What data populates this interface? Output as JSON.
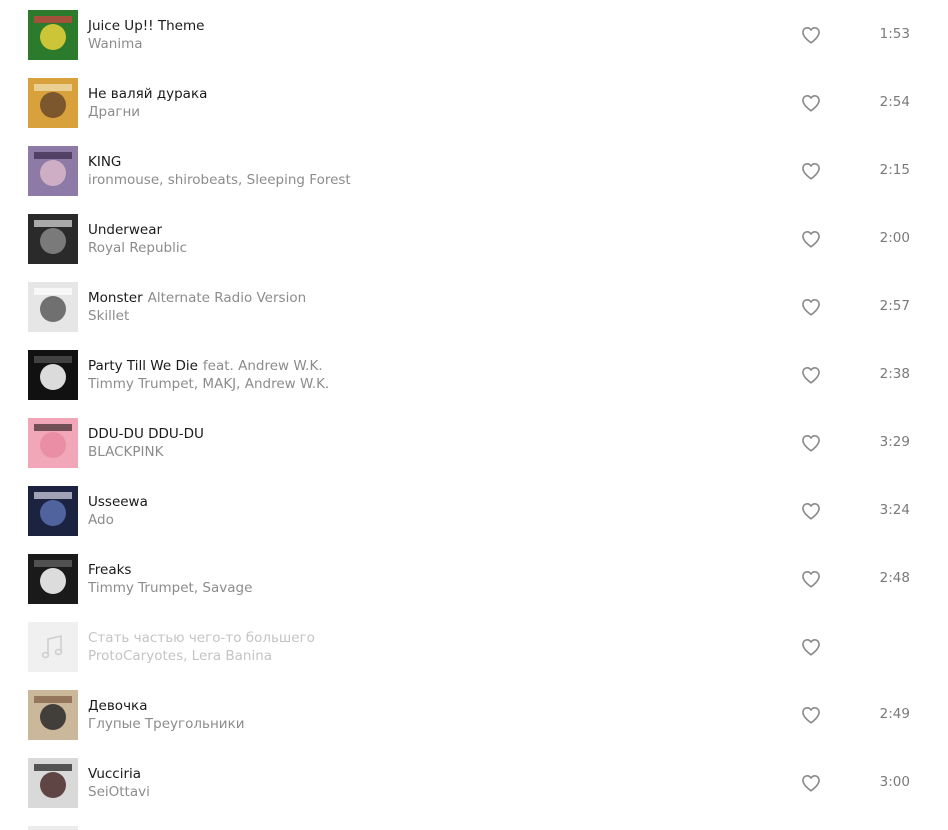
{
  "tracks": [
    {
      "title": "Juice Up!! Theme",
      "version": "",
      "artist": "Wanima",
      "duration": "1:53",
      "cover_icon": "album-cover",
      "cover_colors": [
        "#2c7a2c",
        "#e8d23a",
        "#d64040"
      ]
    },
    {
      "title": "Не валяй дурака",
      "version": "",
      "artist": "Драгни",
      "duration": "2:54",
      "cover_icon": "album-cover",
      "cover_colors": [
        "#d9a13c",
        "#6b4a2a",
        "#f1e3b8"
      ]
    },
    {
      "title": "KING",
      "version": "",
      "artist": "ironmouse, shirobeats, Sleeping Forest",
      "duration": "2:15",
      "cover_icon": "album-cover",
      "cover_colors": [
        "#8e7aa6",
        "#d9b7c9",
        "#3b2a4a"
      ]
    },
    {
      "title": "Underwear",
      "version": "",
      "artist": "Royal Republic",
      "duration": "2:00",
      "cover_icon": "album-cover",
      "cover_colors": [
        "#2a2a2a",
        "#888888",
        "#e0e0e0"
      ]
    },
    {
      "title": "Monster",
      "version": "Alternate Radio Version",
      "artist": "Skillet",
      "duration": "2:57",
      "cover_icon": "album-cover",
      "cover_colors": [
        "#e6e6e6",
        "#5a5a5a",
        "#ffffff"
      ]
    },
    {
      "title": "Party Till We Die",
      "version": "feat. Andrew W.K.",
      "artist": "Timmy Trumpet, MAKJ, Andrew W.K.",
      "duration": "2:38",
      "cover_icon": "album-cover",
      "cover_colors": [
        "#111111",
        "#ffffff",
        "#555555"
      ]
    },
    {
      "title": "DDU-DU DDU-DU",
      "version": "",
      "artist": "BLACKPINK",
      "duration": "3:29",
      "cover_icon": "album-cover",
      "cover_colors": [
        "#f2a7b8",
        "#e88aa0",
        "#3a2a2e"
      ]
    },
    {
      "title": "Usseewa",
      "version": "",
      "artist": "Ado",
      "duration": "3:24",
      "cover_icon": "album-cover",
      "cover_colors": [
        "#1b2340",
        "#5a6fb0",
        "#d8d8e8"
      ]
    },
    {
      "title": "Freaks",
      "version": "",
      "artist": "Timmy Trumpet, Savage",
      "duration": "2:48",
      "cover_icon": "album-cover",
      "cover_colors": [
        "#1a1a1a",
        "#ffffff",
        "#6a6a6a"
      ]
    },
    {
      "title": "Стать частью чего-то большего",
      "version": "",
      "artist": "ProtoCaryotes, Lera Banina",
      "duration": "",
      "cover_icon": "music-note-placeholder-icon",
      "cover_colors": [
        "#f0f0f0",
        "#cfcfcf",
        "#cfcfcf"
      ],
      "unavailable": true
    },
    {
      "title": "Девочка",
      "version": "",
      "artist": "Глупые Треугольники",
      "duration": "2:49",
      "cover_icon": "album-cover",
      "cover_colors": [
        "#cbb79a",
        "#2a2a2a",
        "#7a5a40"
      ]
    },
    {
      "title": "Vucciria",
      "version": "",
      "artist": "SeiOttavi",
      "duration": "3:00",
      "cover_icon": "album-cover",
      "cover_colors": [
        "#d9d9d9",
        "#4a2a2a",
        "#1a1a1a"
      ]
    }
  ],
  "like_icon": "heart-outline-icon",
  "colors": {
    "title": "#1a1a1a",
    "secondary": "#8c8c8c",
    "disabled": "#c4c4c4",
    "heart": "#8a8a8a"
  }
}
